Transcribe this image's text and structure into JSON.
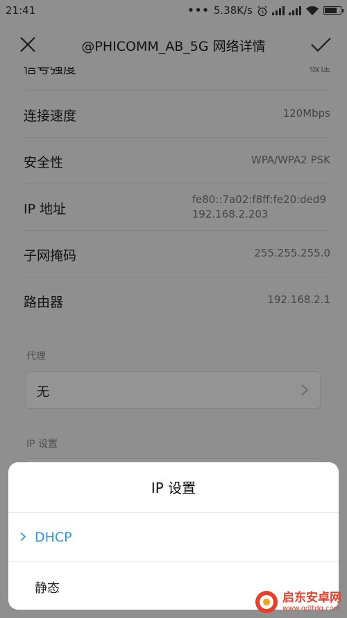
{
  "status_bar": {
    "time": "21:41",
    "dots": "•••",
    "speed": "5.38K/s",
    "icons": [
      "alarm-icon",
      "signal-icon",
      "signal-icon",
      "wifi-icon",
      "battery-icon"
    ]
  },
  "header": {
    "title": "@PHICOMM_AB_5G  网络详情",
    "close_icon": "close-icon",
    "confirm_icon": "check-icon"
  },
  "details": {
    "signal": {
      "label": "信号强度",
      "value": "极佳"
    },
    "speed": {
      "label": "连接速度",
      "value": "120Mbps"
    },
    "security": {
      "label": "安全性",
      "value": "WPA/WPA2 PSK"
    },
    "ip": {
      "label": "IP 地址",
      "value_line1": "fe80::7a02:f8ff:fe20:ded9",
      "value_line2": "192.168.2.203"
    },
    "mask": {
      "label": "子网掩码",
      "value": "255.255.255.0"
    },
    "router": {
      "label": "路由器",
      "value": "192.168.2.1"
    }
  },
  "proxy": {
    "section": "代理",
    "value": "无"
  },
  "ip_settings": {
    "section": "IP 设置"
  },
  "sheet": {
    "title": "IP  设置",
    "options": [
      {
        "label": "DHCP",
        "selected": true
      },
      {
        "label": "静态",
        "selected": false
      }
    ]
  },
  "watermark": {
    "title": "启东安卓网",
    "url": "www.qdltdq.com"
  },
  "colors": {
    "accent": "#2f96e8",
    "overlay": "rgba(0,0,0,0.42)",
    "watermark": "#e8402a"
  }
}
